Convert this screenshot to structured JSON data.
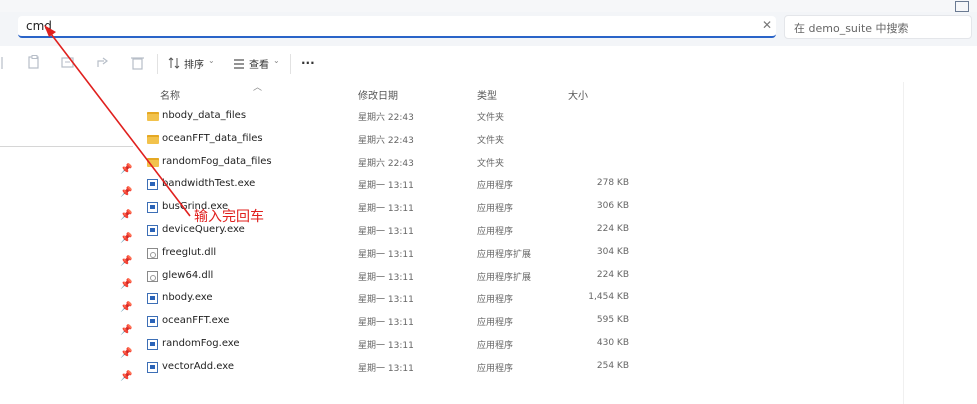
{
  "address": {
    "value": "cmd",
    "clear_icon": "✕"
  },
  "search": {
    "placeholder": "在 demo_suite 中搜索"
  },
  "toolbar": {
    "sort_label": "排序",
    "view_label": "查看",
    "more_label": "···",
    "icons": [
      "cut-icon",
      "copy-icon",
      "rename-icon",
      "share-icon",
      "delete-icon"
    ]
  },
  "columns": {
    "name": "名称",
    "date": "修改日期",
    "type": "类型",
    "size": "大小"
  },
  "files": [
    {
      "name": "nbody_data_files",
      "date": "星期六 22:43",
      "type": "文件夹",
      "size": "",
      "icon": "folder"
    },
    {
      "name": "oceanFFT_data_files",
      "date": "星期六 22:43",
      "type": "文件夹",
      "size": "",
      "icon": "folder"
    },
    {
      "name": "randomFog_data_files",
      "date": "星期六 22:43",
      "type": "文件夹",
      "size": "",
      "icon": "folder"
    },
    {
      "name": "bandwidthTest.exe",
      "date": "星期一 13:11",
      "type": "应用程序",
      "size": "278 KB",
      "icon": "exe"
    },
    {
      "name": "busGrind.exe",
      "date": "星期一 13:11",
      "type": "应用程序",
      "size": "306 KB",
      "icon": "exe"
    },
    {
      "name": "deviceQuery.exe",
      "date": "星期一 13:11",
      "type": "应用程序",
      "size": "224 KB",
      "icon": "exe"
    },
    {
      "name": "freeglut.dll",
      "date": "星期一 13:11",
      "type": "应用程序扩展",
      "size": "304 KB",
      "icon": "dll"
    },
    {
      "name": "glew64.dll",
      "date": "星期一 13:11",
      "type": "应用程序扩展",
      "size": "224 KB",
      "icon": "dll"
    },
    {
      "name": "nbody.exe",
      "date": "星期一 13:11",
      "type": "应用程序",
      "size": "1,454 KB",
      "icon": "exe"
    },
    {
      "name": "oceanFFT.exe",
      "date": "星期一 13:11",
      "type": "应用程序",
      "size": "595 KB",
      "icon": "exe"
    },
    {
      "name": "randomFog.exe",
      "date": "星期一 13:11",
      "type": "应用程序",
      "size": "430 KB",
      "icon": "exe"
    },
    {
      "name": "vectorAdd.exe",
      "date": "星期一 13:11",
      "type": "应用程序",
      "size": "254 KB",
      "icon": "exe"
    }
  ],
  "annotation": {
    "text": "输入完回车",
    "color": "#e0201e"
  },
  "colors": {
    "accent": "#2a64c8",
    "annotation": "#e0201e",
    "folder": "#f2c24c"
  }
}
